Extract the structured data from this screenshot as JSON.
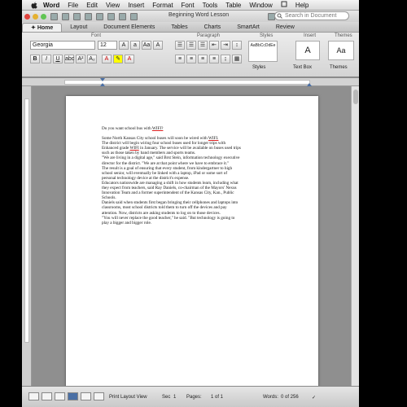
{
  "menubar": {
    "app": "Word",
    "items": [
      "File",
      "Edit",
      "View",
      "Insert",
      "Format",
      "Font",
      "Tools",
      "Table",
      "Window",
      "Help"
    ]
  },
  "window": {
    "title": "Beginning Word Lesson",
    "search_placeholder": "Search in Document"
  },
  "ribbon": {
    "tabs": [
      "Home",
      "Layout",
      "Document Elements",
      "Tables",
      "Charts",
      "SmartArt",
      "Review"
    ],
    "groups": [
      "Font",
      "Paragraph",
      "Styles",
      "Insert",
      "Themes"
    ],
    "font_name": "Georgia",
    "font_size": "12",
    "styles_label": "Styles",
    "text_box_label": "Text Box",
    "themes_label": "Themes",
    "style_preview": "AaBbCcDdEe"
  },
  "document": {
    "title_line": "Do you want school bus with ",
    "title_wifi": "WIFI?",
    "paragraphs": [
      "Some North Kansas City school buses will soon be wired with ",
      "The district will begin wiring four school buses used for longer trips with",
      "Enhanced grade ",
      "such as those taken by band members and sports teams.",
      "\"We are living in a digital age,\" said Brst Stein, information technology executive",
      "director for the district. \"We are at that point where we have to embrace it.\"",
      "The result is a goal of ensuring that every student, from kindergartner to high",
      "school senior, will eventually be linked with a laptop, iPad or some sort of",
      "personal technology device at the district's expense.",
      "Educators nationwide are managing a shift in how students learn, including what",
      "they expect from teachers, said Ray Daniels, co-chairman of the Mayors' Nexus",
      "Innovation Team and a former superintendent of the Kansas City, Kan., Public",
      "Schools.",
      "Daniels said when students first began bringing their cellphones and laptops into",
      "classrooms, most school districts told them to turn off the devices and pay",
      "attention. Now, districts are asking students to log on to those devices.",
      "\"You will never replace the good teacher,\" he said. \"But technology is going to",
      "play a bigger and bigger role."
    ],
    "wifi1": "WIFI.",
    "wifi2": "WIFI",
    "line3_rest": " in January. The service will be available on buses used trips"
  },
  "status": {
    "view": "Print Layout View",
    "sec": "Sec",
    "sec_val": "1",
    "pages_label": "Pages:",
    "pages_val": "1 of 1",
    "words_label": "Words:",
    "words_val": "0 of 256"
  }
}
